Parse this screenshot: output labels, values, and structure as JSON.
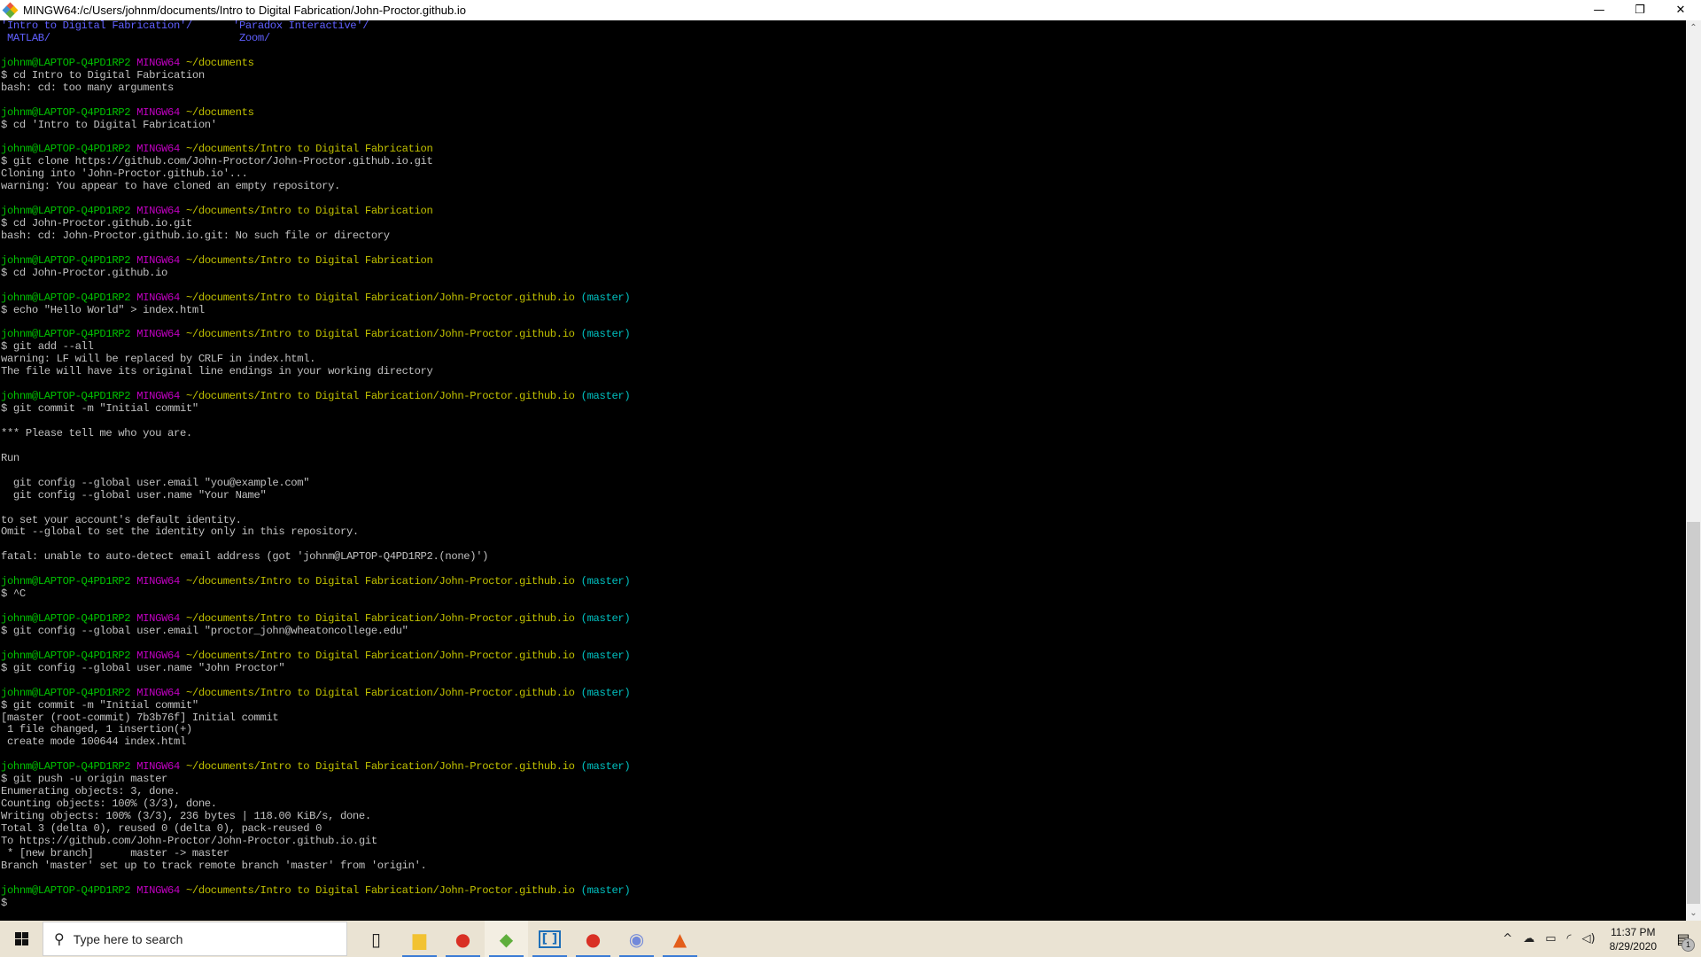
{
  "window": {
    "title": "MINGW64:/c/Users/johnm/documents/Intro to Digital Fabrication/John-Proctor.github.io",
    "controls": {
      "minimize": "—",
      "restore": "❐",
      "close": "✕"
    }
  },
  "prompt": {
    "user_host": "johnm@LAPTOP-Q4PD1RP2",
    "shell": "MINGW64"
  },
  "colors": {
    "user_host": "#00c000",
    "shell": "#c000c0",
    "path": "#c0c000",
    "branch": "#00c0c0",
    "directory": "#6060ff",
    "text": "#c0c0c0",
    "background": "#000000"
  },
  "terminal": {
    "lines": [
      {
        "type": "dirs",
        "cols": [
          "'Intro to Digital Fabrication'/",
          "'Paradox Interactive'/"
        ]
      },
      {
        "type": "dirs",
        "cols": [
          " MATLAB/",
          " Zoom/"
        ]
      },
      {
        "type": "blank"
      },
      {
        "type": "prompt",
        "path": "~/documents",
        "branch": ""
      },
      {
        "type": "text",
        "text": "$ cd Intro to Digital Fabrication"
      },
      {
        "type": "text",
        "text": "bash: cd: too many arguments"
      },
      {
        "type": "blank"
      },
      {
        "type": "prompt",
        "path": "~/documents",
        "branch": ""
      },
      {
        "type": "text",
        "text": "$ cd 'Intro to Digital Fabrication'"
      },
      {
        "type": "blank"
      },
      {
        "type": "prompt",
        "path": "~/documents/Intro to Digital Fabrication",
        "branch": ""
      },
      {
        "type": "text",
        "text": "$ git clone https://github.com/John-Proctor/John-Proctor.github.io.git"
      },
      {
        "type": "text",
        "text": "Cloning into 'John-Proctor.github.io'..."
      },
      {
        "type": "text",
        "text": "warning: You appear to have cloned an empty repository."
      },
      {
        "type": "blank"
      },
      {
        "type": "prompt",
        "path": "~/documents/Intro to Digital Fabrication",
        "branch": ""
      },
      {
        "type": "text",
        "text": "$ cd John-Proctor.github.io.git"
      },
      {
        "type": "text",
        "text": "bash: cd: John-Proctor.github.io.git: No such file or directory"
      },
      {
        "type": "blank"
      },
      {
        "type": "prompt",
        "path": "~/documents/Intro to Digital Fabrication",
        "branch": ""
      },
      {
        "type": "text",
        "text": "$ cd John-Proctor.github.io"
      },
      {
        "type": "blank"
      },
      {
        "type": "prompt",
        "path": "~/documents/Intro to Digital Fabrication/John-Proctor.github.io",
        "branch": "(master)"
      },
      {
        "type": "text",
        "text": "$ echo \"Hello World\" > index.html"
      },
      {
        "type": "blank"
      },
      {
        "type": "prompt",
        "path": "~/documents/Intro to Digital Fabrication/John-Proctor.github.io",
        "branch": "(master)"
      },
      {
        "type": "text",
        "text": "$ git add --all"
      },
      {
        "type": "text",
        "text": "warning: LF will be replaced by CRLF in index.html."
      },
      {
        "type": "text",
        "text": "The file will have its original line endings in your working directory"
      },
      {
        "type": "blank"
      },
      {
        "type": "prompt",
        "path": "~/documents/Intro to Digital Fabrication/John-Proctor.github.io",
        "branch": "(master)"
      },
      {
        "type": "text",
        "text": "$ git commit -m \"Initial commit\""
      },
      {
        "type": "blank"
      },
      {
        "type": "text",
        "text": "*** Please tell me who you are."
      },
      {
        "type": "blank"
      },
      {
        "type": "text",
        "text": "Run"
      },
      {
        "type": "blank"
      },
      {
        "type": "text",
        "text": "  git config --global user.email \"you@example.com\""
      },
      {
        "type": "text",
        "text": "  git config --global user.name \"Your Name\""
      },
      {
        "type": "blank"
      },
      {
        "type": "text",
        "text": "to set your account's default identity."
      },
      {
        "type": "text",
        "text": "Omit --global to set the identity only in this repository."
      },
      {
        "type": "blank"
      },
      {
        "type": "text",
        "text": "fatal: unable to auto-detect email address (got 'johnm@LAPTOP-Q4PD1RP2.(none)')"
      },
      {
        "type": "blank"
      },
      {
        "type": "prompt",
        "path": "~/documents/Intro to Digital Fabrication/John-Proctor.github.io",
        "branch": "(master)"
      },
      {
        "type": "text",
        "text": "$ ^C"
      },
      {
        "type": "blank"
      },
      {
        "type": "prompt",
        "path": "~/documents/Intro to Digital Fabrication/John-Proctor.github.io",
        "branch": "(master)"
      },
      {
        "type": "text",
        "text": "$ git config --global user.email \"proctor_john@wheatoncollege.edu\""
      },
      {
        "type": "blank"
      },
      {
        "type": "prompt",
        "path": "~/documents/Intro to Digital Fabrication/John-Proctor.github.io",
        "branch": "(master)"
      },
      {
        "type": "text",
        "text": "$ git config --global user.name \"John Proctor\""
      },
      {
        "type": "blank"
      },
      {
        "type": "prompt",
        "path": "~/documents/Intro to Digital Fabrication/John-Proctor.github.io",
        "branch": "(master)"
      },
      {
        "type": "text",
        "text": "$ git commit -m \"Initial commit\""
      },
      {
        "type": "text",
        "text": "[master (root-commit) 7b3b76f] Initial commit"
      },
      {
        "type": "text",
        "text": " 1 file changed, 1 insertion(+)"
      },
      {
        "type": "text",
        "text": " create mode 100644 index.html"
      },
      {
        "type": "blank"
      },
      {
        "type": "prompt",
        "path": "~/documents/Intro to Digital Fabrication/John-Proctor.github.io",
        "branch": "(master)"
      },
      {
        "type": "text",
        "text": "$ git push -u origin master"
      },
      {
        "type": "text",
        "text": "Enumerating objects: 3, done."
      },
      {
        "type": "text",
        "text": "Counting objects: 100% (3/3), done."
      },
      {
        "type": "text",
        "text": "Writing objects: 100% (3/3), 236 bytes | 118.00 KiB/s, done."
      },
      {
        "type": "text",
        "text": "Total 3 (delta 0), reused 0 (delta 0), pack-reused 0"
      },
      {
        "type": "text",
        "text": "To https://github.com/John-Proctor/John-Proctor.github.io.git"
      },
      {
        "type": "text",
        "text": " * [new branch]      master -> master"
      },
      {
        "type": "text",
        "text": "Branch 'master' set up to track remote branch 'master' from 'origin'."
      },
      {
        "type": "blank"
      },
      {
        "type": "prompt",
        "path": "~/documents/Intro to Digital Fabrication/John-Proctor.github.io",
        "branch": "(master)"
      },
      {
        "type": "text",
        "text": "$"
      }
    ]
  },
  "scrollbar": {
    "up_arrow": "⌃",
    "down_arrow": "⌄",
    "scroll_position_fraction": 0.58,
    "visible_fraction": 0.42
  },
  "taskbar": {
    "search_placeholder": "Type here to search",
    "search_icon": "⚲",
    "apps": [
      {
        "name": "task-view",
        "glyph": "▯",
        "running": false,
        "active": false
      },
      {
        "name": "file-explorer",
        "glyph": "▆",
        "running": true,
        "active": false,
        "color": "#f2c232"
      },
      {
        "name": "chrome",
        "glyph": "●",
        "running": true,
        "active": false,
        "color": "#d93025"
      },
      {
        "name": "git-gui",
        "glyph": "◆",
        "running": true,
        "active": true,
        "color": "#5fae3c"
      },
      {
        "name": "brackets",
        "glyph": "[ ]",
        "running": true,
        "active": false,
        "color": "#1e6fb8"
      },
      {
        "name": "chrome-2",
        "glyph": "●",
        "running": true,
        "active": false,
        "color": "#d93025"
      },
      {
        "name": "discord",
        "glyph": "◉",
        "running": true,
        "active": false,
        "color": "#7289da"
      },
      {
        "name": "matlab",
        "glyph": "▲",
        "running": true,
        "active": false,
        "color": "#e35e1b"
      }
    ],
    "tray": {
      "chevron": "^",
      "onedrive": "☁",
      "battery": "🔋",
      "wifi": "◜",
      "volume": "🔊",
      "time": "11:37 PM",
      "date": "8/29/2020",
      "notifications_count": "1"
    }
  }
}
